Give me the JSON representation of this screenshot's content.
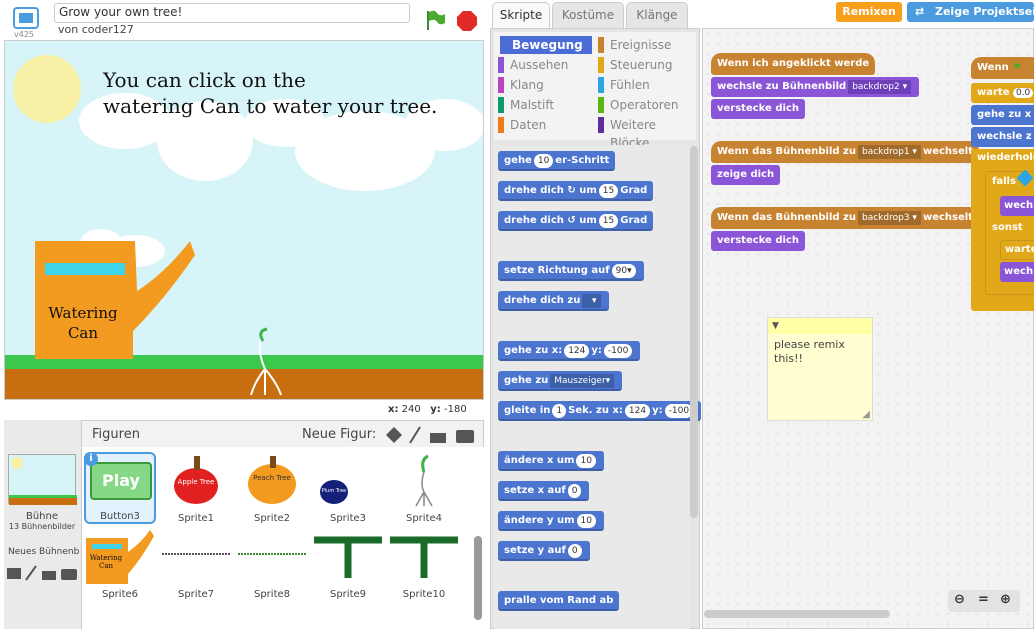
{
  "editor": {
    "version": "v425",
    "project_title": "Grow your own tree!",
    "author": "von coder127",
    "remix_label": "Remixen",
    "project_page_label": "Zeige Projektseite"
  },
  "stage": {
    "text_line1": "You can click on the",
    "text_line2": "watering Can to water your tree.",
    "can_label_line1": "Watering",
    "can_label_line2": "Can",
    "x_label": "x:",
    "x_value": "240",
    "y_label": "y:",
    "y_value": "-180"
  },
  "sprites": {
    "header": "Figuren",
    "new_figure_label": "Neue Figur:",
    "stage_label": "Bühne",
    "stage_backdrops": "13 Bühnenbilder",
    "new_backdrop_label": "Neues Bühnenbild:",
    "items": [
      {
        "name": "Button3",
        "art": "Play"
      },
      {
        "name": "Sprite1",
        "art": "Apple Tree"
      },
      {
        "name": "Sprite2",
        "art": "Peach Tree"
      },
      {
        "name": "Sprite3",
        "art": "Plum Tree"
      },
      {
        "name": "Sprite4",
        "art": ""
      },
      {
        "name": "Sprite6",
        "art": "Watering Can"
      },
      {
        "name": "Sprite7",
        "art": ""
      },
      {
        "name": "Sprite8",
        "art": ""
      },
      {
        "name": "Sprite9",
        "art": ""
      },
      {
        "name": "Sprite10",
        "art": ""
      }
    ]
  },
  "tabs": [
    "Skripte",
    "Kostüme",
    "Klänge"
  ],
  "categories": [
    {
      "label": "Bewegung",
      "color": "#4a6cd4"
    },
    {
      "label": "Ereignisse",
      "color": "#c88330"
    },
    {
      "label": "Aussehen",
      "color": "#8a55d7"
    },
    {
      "label": "Steuerung",
      "color": "#e1a91a"
    },
    {
      "label": "Klang",
      "color": "#bb42c3"
    },
    {
      "label": "Fühlen",
      "color": "#2ca5e2"
    },
    {
      "label": "Malstift",
      "color": "#0e9a6c"
    },
    {
      "label": "Operatoren",
      "color": "#5cb712"
    },
    {
      "label": "Daten",
      "color": "#ee7d16"
    },
    {
      "label": "Weitere Blöcke",
      "color": "#632d99"
    }
  ],
  "palette": {
    "b1": {
      "a": "gehe",
      "n": "10",
      "b": "er-Schritt"
    },
    "b2": {
      "a": "drehe dich",
      "b": "um",
      "n": "15",
      "c": "Grad"
    },
    "b3": {
      "a": "drehe dich",
      "b": "um",
      "n": "15",
      "c": "Grad"
    },
    "b4": {
      "a": "setze Richtung auf",
      "n": "90"
    },
    "b5": {
      "a": "drehe dich zu"
    },
    "b6": {
      "a": "gehe zu x:",
      "n1": "124",
      "b": "y:",
      "n2": "-100"
    },
    "b7": {
      "a": "gehe zu",
      "d": "Mauszeiger"
    },
    "b8": {
      "a": "gleite in",
      "n1": "1",
      "b": "Sek. zu x:",
      "n2": "124",
      "c": "y:",
      "n3": "-100"
    },
    "b9": {
      "a": "ändere x um",
      "n": "10"
    },
    "b10": {
      "a": "setze x auf",
      "n": "0"
    },
    "b11": {
      "a": "ändere y um",
      "n": "10"
    },
    "b12": {
      "a": "setze y auf",
      "n": "0"
    },
    "b13": {
      "a": "pralle vom Rand ab"
    }
  },
  "scripts": {
    "s1_hat": "Wenn ich angeklickt werde",
    "s1_b1a": "wechsle zu Bühnenbild",
    "s1_b1d": "backdrop2",
    "s1_b2": "verstecke dich",
    "s2_hata": "Wenn das Bühnenbild zu",
    "s2_hatd": "backdrop1",
    "s2_hatb": "wechselt",
    "s2_b1": "zeige dich",
    "s3_hata": "Wenn das Bühnenbild zu",
    "s3_hatd": "backdrop3",
    "s3_hatb": "wechselt",
    "s3_b1": "verstecke dich",
    "s4_hat": "Wenn",
    "s4_b1a": "warte",
    "s4_b1n": "0.0",
    "s4_b2": "gehe zu x",
    "s4_b3": "wechsle z",
    "s4_b4": "wiederhole",
    "s4_b5": "falls",
    "s4_b6": "wech",
    "s4_b7": "sonst",
    "s4_b8": "warte",
    "s4_b9": "wech",
    "note": "please remix this!!"
  }
}
